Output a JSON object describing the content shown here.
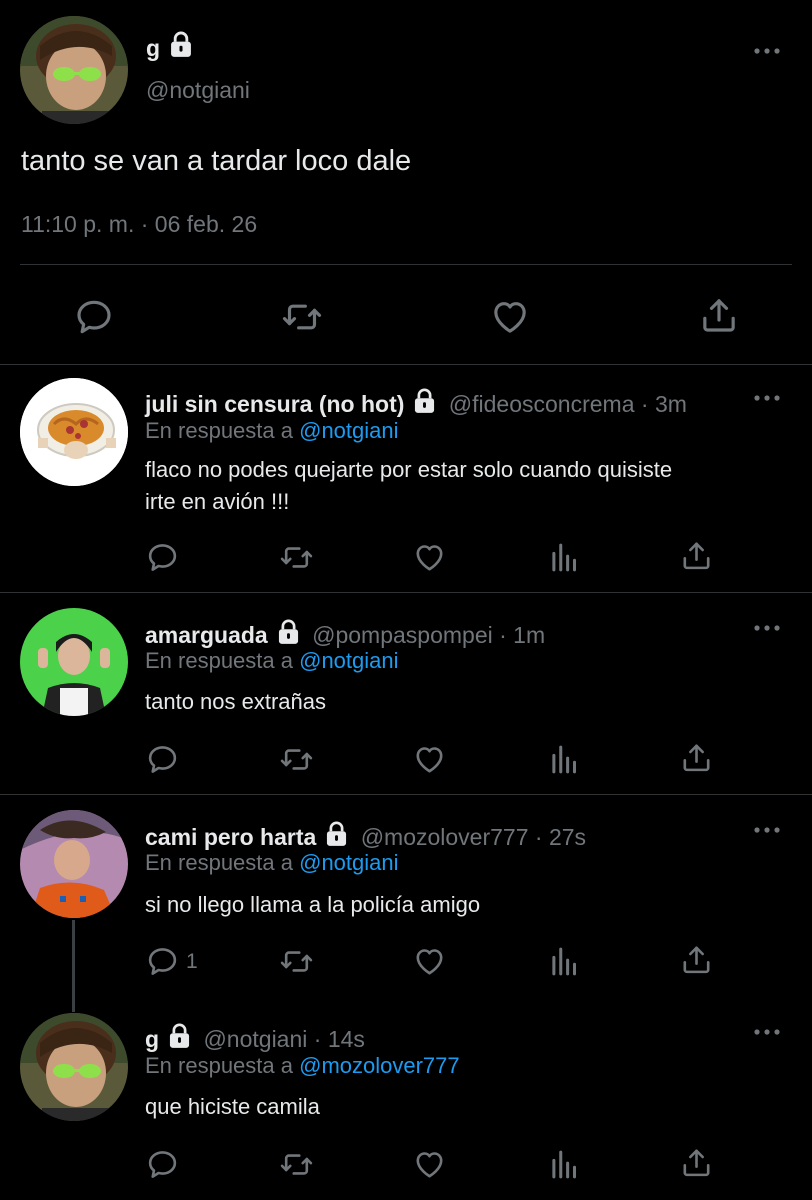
{
  "main_tweet": {
    "name": "g",
    "handle": "@notgiani",
    "text": "tanto se van a tardar loco dale",
    "timestamp": "11:10 p. m. · 06 feb. 26"
  },
  "replies": [
    {
      "name": "juli sin censura (no hot)",
      "handle": "@fideosconcrema",
      "time": "· 3m",
      "reply_prefix": "En respuesta a",
      "reply_to": "@notgiani",
      "text_lines": [
        "flaco no podes quejarte por estar solo cuando quisiste",
        "irte en avión !!!"
      ]
    },
    {
      "name": "amarguada",
      "handle": "@pompaspompei",
      "time": "· 1m",
      "reply_prefix": "En respuesta a",
      "reply_to": "@notgiani",
      "text_lines": [
        "tanto nos extrañas"
      ]
    },
    {
      "name": "cami pero harta",
      "handle": "@mozolover777",
      "time": "· 27s",
      "reply_prefix": "En respuesta a",
      "reply_to": "@notgiani",
      "text_lines": [
        "si no llego llama a la policía amigo"
      ],
      "reply_count": "1"
    },
    {
      "name": "g",
      "handle": "@notgiani",
      "time": "· 14s",
      "reply_prefix": "En respuesta a",
      "reply_to": "@mozolover777",
      "text_lines": [
        "que hiciste camila"
      ]
    }
  ],
  "colors": {
    "background": "#000000",
    "text": "#e7e9ea",
    "muted": "#71767b",
    "link": "#1d9bf0",
    "divider": "#2f3336"
  },
  "icons": [
    "lock-icon",
    "more-icon",
    "reply-icon",
    "retweet-icon",
    "like-icon",
    "share-icon",
    "analytics-icon"
  ]
}
